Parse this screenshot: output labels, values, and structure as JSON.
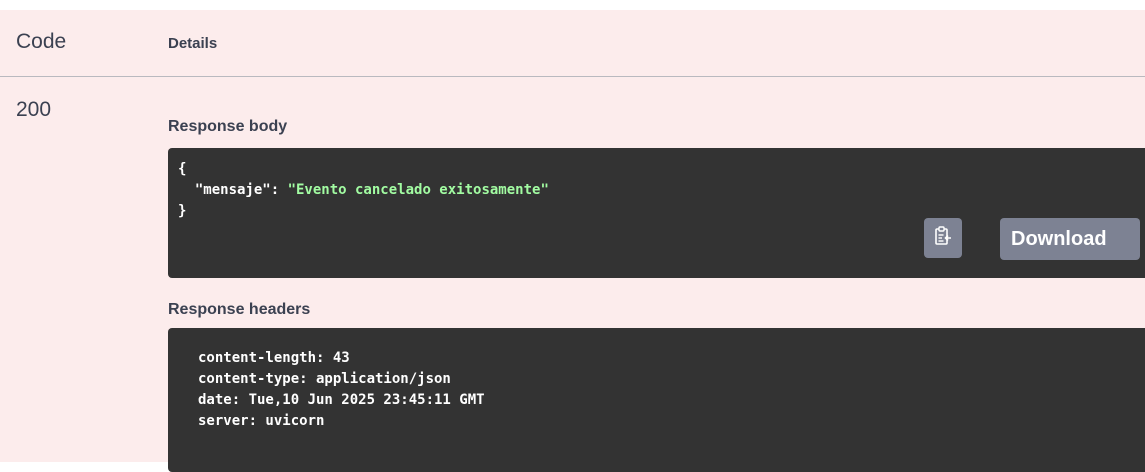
{
  "table": {
    "code_header": "Code",
    "details_header": "Details"
  },
  "response": {
    "status_code": "200",
    "body_label": "Response body",
    "body": {
      "open_brace": "{",
      "key": "\"mensaje\"",
      "colon": ": ",
      "value": "\"Evento cancelado exitosamente\"",
      "close_brace": "}"
    },
    "copy_icon": "clipboard-copy-icon",
    "download_label": "Download",
    "headers_label": "Response headers",
    "headers": [
      "content-length: 43",
      "content-type: application/json",
      "date: Tue,10 Jun 2025 23:45:11 GMT",
      "server: uvicorn"
    ]
  },
  "colors": {
    "panel_bg": "#fcecec",
    "code_bg": "#333333",
    "string_green": "#a2fca2",
    "button_gray": "#7d8293"
  }
}
